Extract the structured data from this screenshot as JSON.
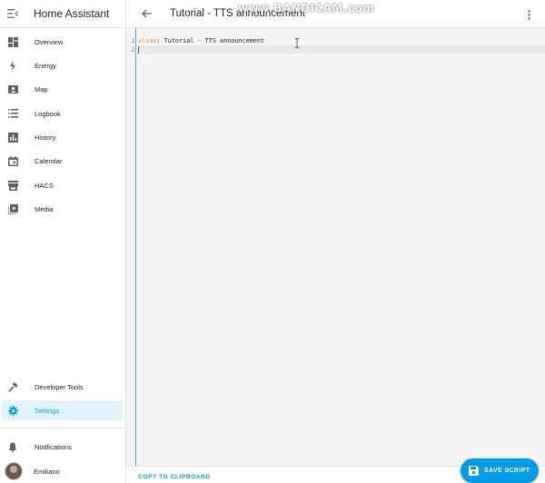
{
  "app": {
    "title": "Home Assistant",
    "menu_icon": "menu-open-icon"
  },
  "sidebar": {
    "items": [
      {
        "label": "Overview",
        "icon": "dashboard-icon"
      },
      {
        "label": "Energy",
        "icon": "lightning-bolt-icon"
      },
      {
        "label": "Map",
        "icon": "map-icon"
      },
      {
        "label": "Logbook",
        "icon": "list-icon"
      },
      {
        "label": "History",
        "icon": "chart-bar-icon"
      },
      {
        "label": "Calendar",
        "icon": "calendar-icon"
      },
      {
        "label": "HACS",
        "icon": "store-icon"
      },
      {
        "label": "Media",
        "icon": "play-box-icon"
      }
    ],
    "bottom_items": [
      {
        "label": "Developer Tools",
        "icon": "hammer-icon"
      },
      {
        "label": "Settings",
        "icon": "gear-icon",
        "active": true
      }
    ],
    "notifications": {
      "label": "Notifications",
      "icon": "bell-icon"
    },
    "user": {
      "label": "Emiliano",
      "icon": "avatar"
    }
  },
  "header": {
    "title": "Tutorial - TTS announcement",
    "back_icon": "arrow-left-icon",
    "more_icon": "dots-vertical-icon"
  },
  "watermark": {
    "text": "www.BANDICAM.com"
  },
  "editor": {
    "lines": [
      {
        "number": "1",
        "key": "alias",
        "sep": ": ",
        "value": "Tutorial - TTS announcement"
      },
      {
        "number": "2",
        "key": "",
        "sep": "",
        "value": ""
      }
    ]
  },
  "footer": {
    "copy_label": "COPY TO CLIPBOARD"
  },
  "save_button": {
    "label": "SAVE SCRIPT",
    "icon": "floppy-disk-icon"
  },
  "colors": {
    "accent": "#039be5",
    "yaml_key": "#e9961f",
    "active_bg": "#e3f3fb"
  }
}
